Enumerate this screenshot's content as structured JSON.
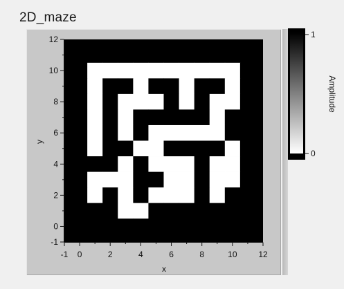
{
  "window": {
    "title": "2D_maze"
  },
  "chart_data": {
    "type": "heatmap",
    "title": "2D_maze",
    "xlabel": "x",
    "ylabel": "y",
    "xlim": [
      -1,
      12
    ],
    "ylim": [
      -1,
      12
    ],
    "xticks": [
      "-1",
      "0",
      "2",
      "4",
      "6",
      "8",
      "10",
      "12"
    ],
    "xtick_values": [
      -1,
      0,
      2,
      4,
      6,
      8,
      10,
      12
    ],
    "yticks": [
      "-1",
      "0",
      "2",
      "4",
      "6",
      "8",
      "10",
      "12"
    ],
    "ytick_values": [
      -1,
      0,
      2,
      4,
      6,
      8,
      10,
      12
    ],
    "colorbar": {
      "label": "Amplitude",
      "min_label": "0",
      "max_label": "1",
      "min": 0,
      "max": 1,
      "low_color": "#ffffff",
      "high_color": "#000000"
    },
    "grid": false,
    "x_values": [
      0,
      1,
      2,
      3,
      4,
      5,
      6,
      7,
      8,
      9,
      10,
      11
    ],
    "y_values": [
      0,
      1,
      2,
      3,
      4,
      5,
      6,
      7,
      8,
      9,
      10,
      11
    ],
    "rows_top_to_bottom": [
      [
        1,
        1,
        1,
        1,
        1,
        1,
        1,
        1,
        1,
        1,
        1,
        1
      ],
      [
        1,
        0,
        0,
        0,
        0,
        0,
        0,
        0,
        0,
        0,
        0,
        1
      ],
      [
        1,
        0,
        1,
        1,
        0,
        1,
        1,
        0,
        1,
        1,
        0,
        1
      ],
      [
        1,
        0,
        1,
        0,
        0,
        0,
        1,
        0,
        1,
        0,
        0,
        1
      ],
      [
        1,
        0,
        1,
        0,
        1,
        1,
        1,
        1,
        1,
        0,
        1,
        1
      ],
      [
        1,
        0,
        1,
        0,
        1,
        0,
        0,
        0,
        0,
        0,
        1,
        1
      ],
      [
        1,
        0,
        1,
        1,
        0,
        0,
        1,
        1,
        1,
        1,
        0,
        1
      ],
      [
        1,
        1,
        1,
        0,
        1,
        0,
        0,
        0,
        1,
        0,
        0,
        1
      ],
      [
        1,
        0,
        0,
        0,
        1,
        1,
        0,
        0,
        1,
        0,
        0,
        1
      ],
      [
        1,
        0,
        1,
        0,
        1,
        0,
        0,
        0,
        1,
        0,
        1,
        1
      ],
      [
        1,
        1,
        1,
        0,
        0,
        1,
        1,
        1,
        1,
        1,
        1,
        1
      ],
      [
        1,
        1,
        1,
        1,
        1,
        1,
        1,
        1,
        1,
        1,
        1,
        1
      ]
    ]
  }
}
